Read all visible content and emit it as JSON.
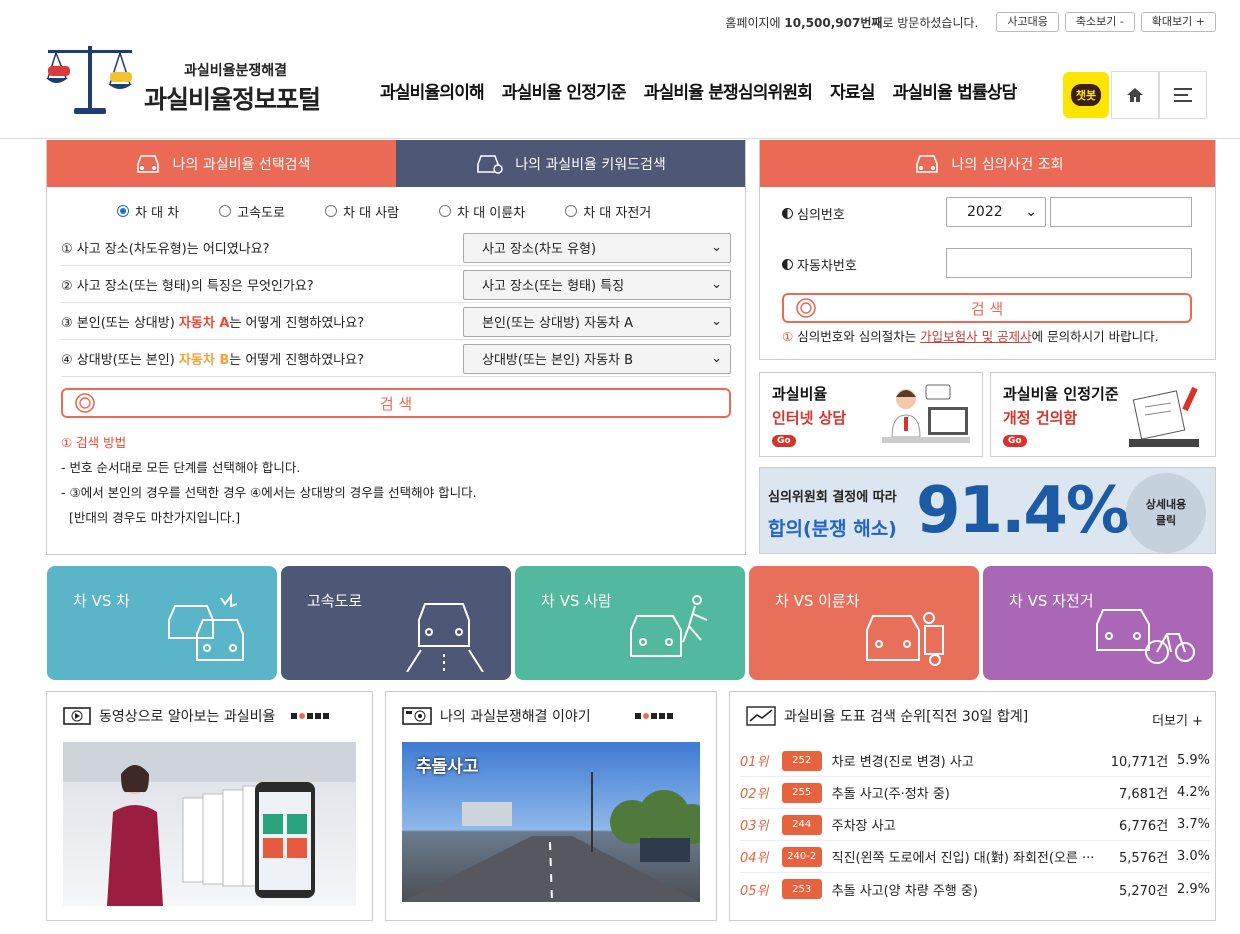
{
  "topbar": {
    "visit_prefix": "홈페이지에 ",
    "visit_count": "10,500,907번째",
    "visit_suffix": "로 방문하셨습니다.",
    "btn_accident": "사고대응",
    "btn_zoom_out": "축소보기 -",
    "btn_zoom_in": "확대보기 +"
  },
  "logo": {
    "sub": "과실비율분쟁해결",
    "main": "과실비율정보포털"
  },
  "nav": [
    "과실비율의이해",
    "과실비율 인정기준",
    "과실비율 분쟁심의위원회",
    "자료실",
    "과실비율 법률상담"
  ],
  "chatbot": "챗봇",
  "left_search": {
    "tab_select": "나의 과실비율 선택검색",
    "tab_keyword": "나의 과실비율 키워드검색",
    "radios": [
      "차 대 차",
      "고속도로",
      "차 대 사람",
      "차 대 이륜차",
      "차 대 자전거"
    ],
    "q1": "① 사고 장소(차도유형)는 어디였나요?",
    "q2": "② 사고 장소(또는 형태)의 특징은 무엇인가요?",
    "q3_pre": "③ 본인(또는 상대방) ",
    "q3_hl": "자동차 A",
    "q3_post": "는 어떻게 진행하였나요?",
    "q4_pre": "④ 상대방(또는 본인) ",
    "q4_hl": "자동차 B",
    "q4_post": "는 어떻게 진행하였나요?",
    "s1": "사고 장소(차도 유형)",
    "s2": "사고 장소(또는 형태) 특징",
    "s3": "본인(또는 상대방) 자동차 A",
    "s4": "상대방(또는 본인) 자동차 B",
    "search_btn": "검 색",
    "howto_title": "①  검색 방법",
    "howto_1": "- 번호 순서대로 모든 단계를 선택해야 합니다.",
    "howto_2": "- ③에서 본인의 경우를 선택한 경우 ④에서는 상대방의 경우를 선택해야 합니다.",
    "howto_3": "  [반대의 경우도 마찬가지입니다.]"
  },
  "case_lookup": {
    "title": "나의 심의사건 조회",
    "label_no": "심의번호",
    "year": "2022",
    "label_car": "자동차번호",
    "search_btn": "검 색",
    "notice_icon": "①",
    "notice_pre": "심의번호와 심의절차는 ",
    "notice_link": "가입보험사 및 공제사",
    "notice_post": "에 문의하시기 바랍니다."
  },
  "banners": {
    "b1_t1": "과실비율",
    "b1_t2": "인터넷 상담",
    "b2_t1": "과실비율 인정기준",
    "b2_t2": "개정 건의함",
    "go": "Go"
  },
  "stat": {
    "s1": "심의위원회 결정에 따라",
    "s2": "합의(분쟁 해소)",
    "pct": "91.4%",
    "detail": "상세내용\n클릭"
  },
  "tiles": [
    "차 VS 차",
    "고속도로",
    "차 VS 사람",
    "차 VS 이륜차",
    "차 VS 자전거"
  ],
  "colors": {
    "accent": "#ea6a55",
    "navy": "#4d5877",
    "tile_colors": [
      "#5ab5c9",
      "#4d5877",
      "#53b99e",
      "#e8705a",
      "#a967b6"
    ]
  },
  "video_box": {
    "title": "동영상으로 알아보는 과실비율"
  },
  "story_box": {
    "title": "나의 과실분쟁해결 이야기",
    "caption": "추돌사고"
  },
  "ranking": {
    "title": "과실비율 도표 검색 순위[직전 30일 합계]",
    "more": "더보기 +",
    "rows": [
      {
        "rank": "01위",
        "code": "252",
        "text": "차로 변경(진로 변경) 사고",
        "count": "10,771건",
        "pct": "5.9%"
      },
      {
        "rank": "02위",
        "code": "255",
        "text": "추돌 사고(주·정차 중)",
        "count": "7,681건",
        "pct": "4.2%"
      },
      {
        "rank": "03위",
        "code": "244",
        "text": "주차장 사고",
        "count": "6,776건",
        "pct": "3.7%"
      },
      {
        "rank": "04위",
        "code": "240-2",
        "text": "직진(왼쪽 도로에서 진입) 대(對) 좌회전(오른 ···",
        "count": "5,576건",
        "pct": "3.0%"
      },
      {
        "rank": "05위",
        "code": "253",
        "text": "추돌 사고(양 차량 주행 중)",
        "count": "5,270건",
        "pct": "2.9%"
      }
    ]
  }
}
